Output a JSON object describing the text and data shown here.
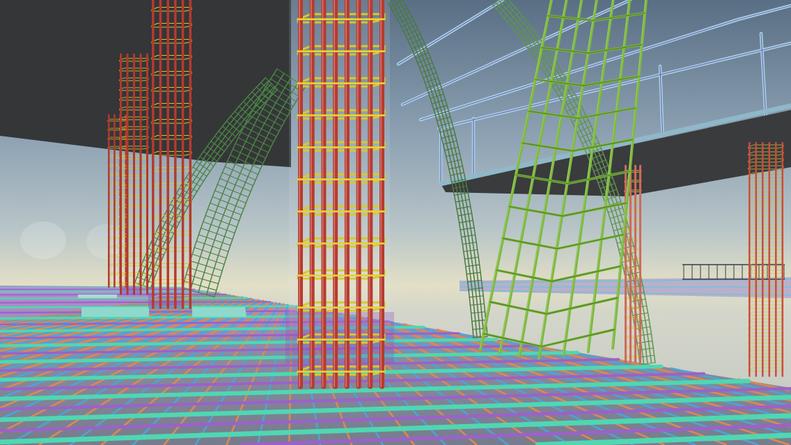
{
  "scene": {
    "cages": [
      {
        "kind": "column",
        "color": "#b2382d"
      },
      {
        "kind": "column",
        "color": "#b2382d"
      },
      {
        "kind": "arch",
        "color": "#4b8546"
      },
      {
        "kind": "column",
        "color": "#b53a2e"
      },
      {
        "kind": "arch",
        "color": "#4b8546"
      },
      {
        "kind": "column",
        "color": "#b83a2f"
      },
      {
        "kind": "arch",
        "color": "#4a7a42"
      },
      {
        "kind": "inclined",
        "color": "#7db93d"
      },
      {
        "kind": "arch",
        "color": "#5f9450"
      },
      {
        "kind": "column",
        "color": "#cf6a5c"
      },
      {
        "kind": "column",
        "color": "#c84d3f"
      }
    ]
  }
}
